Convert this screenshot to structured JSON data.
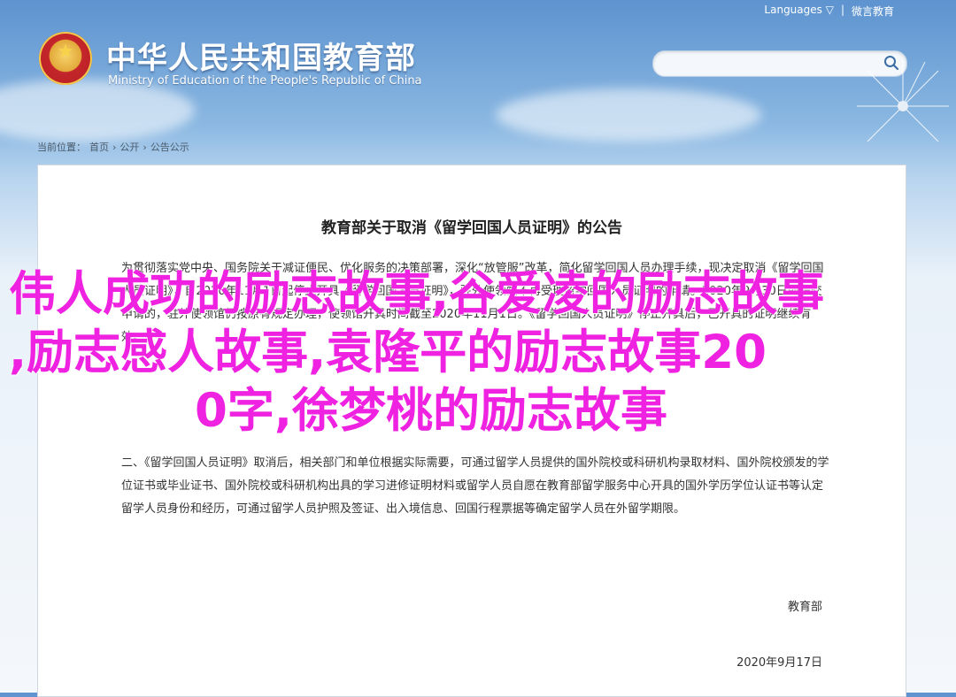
{
  "header": {
    "languages": "Languages ▽",
    "weibo": "微言教育",
    "site_title": "中华人民共和国教育部",
    "site_subtitle": "Ministry of Education of the People's Republic of China"
  },
  "search": {
    "value": "",
    "placeholder": ""
  },
  "breadcrumb": {
    "prefix": "当前位置：",
    "items": [
      "首页",
      "公开",
      "公告公示"
    ]
  },
  "document": {
    "title": "教育部关于取消《留学回国人员证明》的公告",
    "paragraph1": "为贯彻落实党中央、国务院关于减证便民、优化服务的决策部署，深化“放管服”改革，简化留学回国人员办理手续，现决定取消《留学回国人员证明》，自2020年11月1日起停止开具《留学回国人员证明》，驻外使领馆不再受理留学回国人员证明的申请。2020年9月30日前提交申请的，驻外使领馆仍按原有规定办理，使领馆开具时间截至2020年11月1日。《留学回国人员证明》停止开具后，已开具的证明继续有效。",
    "paragraph2": "二、《留学回国人员证明》取消后，相关部门和单位根据实际需要，可通过留学人员提供的国外院校或科研机构录取材料、国外院校颁发的学位证书或毕业证书、国外院校或科研机构出具的学习进修证明材料或留学人员自愿在教育部留学服务中心开具的国外学历学位认证书等认定留学人员身份和经历，可通过留学人员护照及签证、出入境信息、回国行程票据等确定留学人员在外留学期限。",
    "signature": "教育部",
    "date": "2020年9月17日"
  },
  "overlay": {
    "line1": "伟人成功的励志故事,谷爱凌的励志故事",
    "line2": ",励志感人故事,袁隆平的励志故事20",
    "line3": "0字,徐梦桃的励志故事"
  },
  "colors": {
    "overlay": "#ee22e0",
    "sky": "#5d93cf"
  }
}
